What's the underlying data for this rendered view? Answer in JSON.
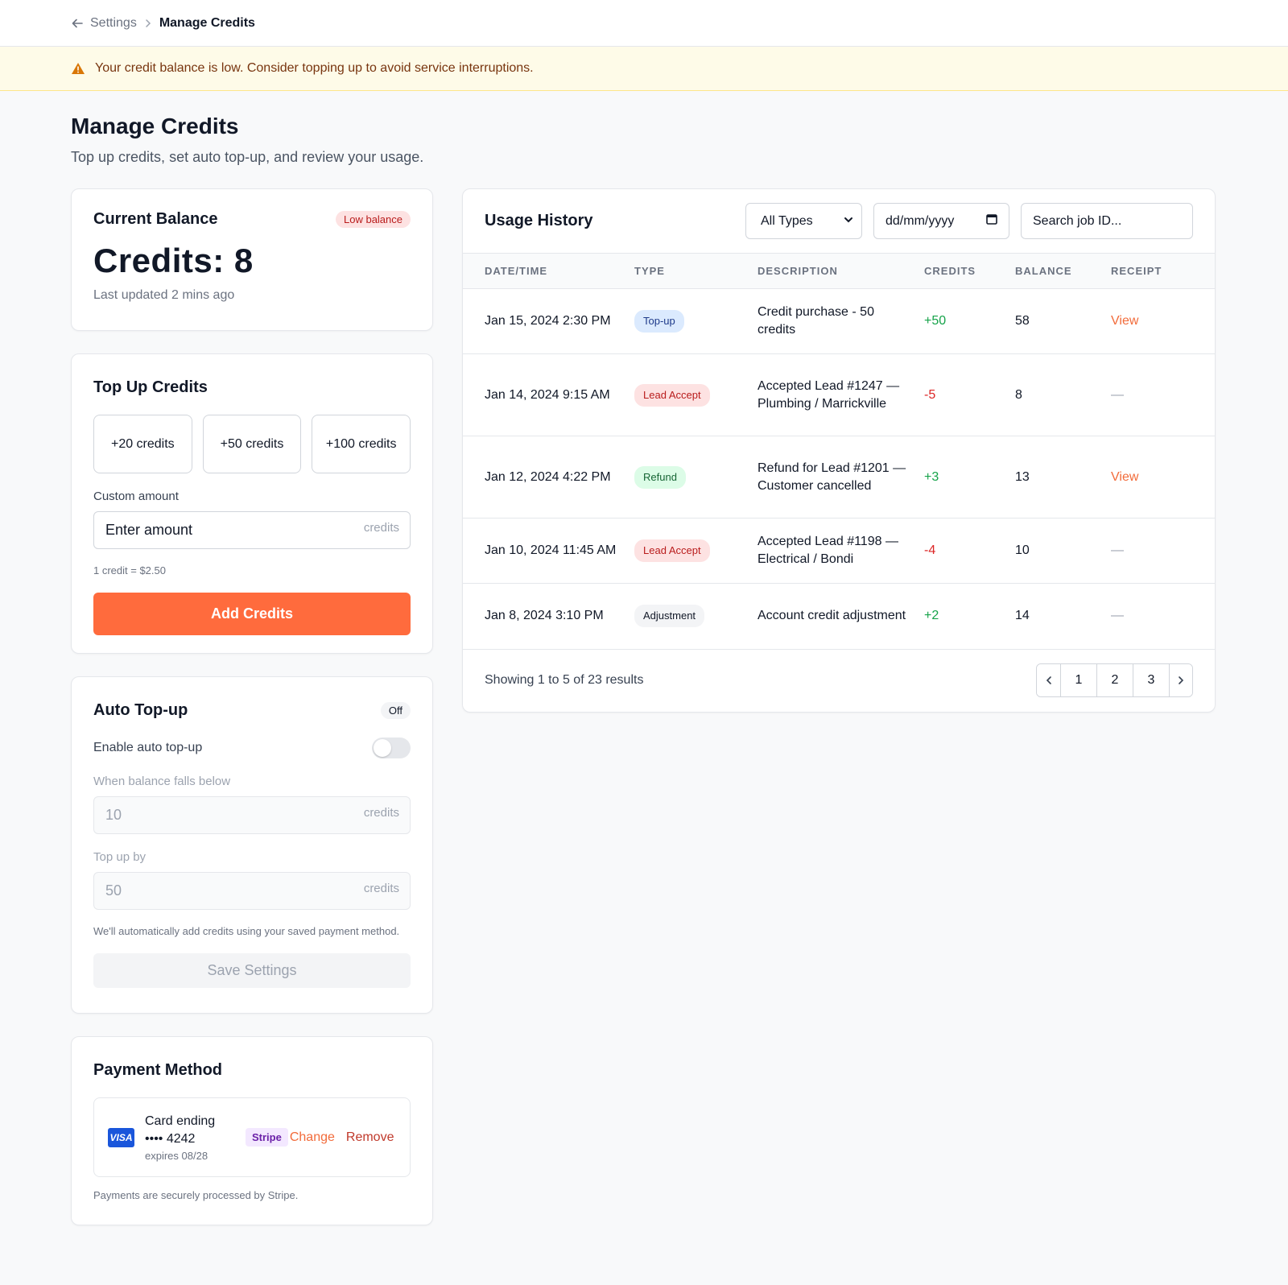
{
  "breadcrumb": {
    "parent": "Settings",
    "current": "Manage Credits"
  },
  "banner": {
    "text": "Your credit balance is low. Consider topping up to avoid service interruptions."
  },
  "page": {
    "title": "Manage Credits",
    "subtitle": "Top up credits, set auto top-up, and review your usage."
  },
  "balance": {
    "title": "Current Balance",
    "badge": "Low balance",
    "credits": "Credits: 8",
    "updated": "Last updated 2 mins ago"
  },
  "topup": {
    "title": "Top Up Credits",
    "quick": [
      "+20 credits",
      "+50 credits",
      "+100 credits"
    ],
    "custom_label": "Custom amount",
    "custom_placeholder": "Enter amount",
    "suffix": "credits",
    "rate": "1 credit = $2.50",
    "button": "Add Credits"
  },
  "auto": {
    "title": "Auto Top-up",
    "status": "Off",
    "enable_label": "Enable auto top-up",
    "threshold_label": "When balance falls below",
    "threshold_value": "10",
    "amount_label": "Top up by",
    "amount_value": "50",
    "suffix": "credits",
    "note": "We'll automatically add credits using your saved payment method.",
    "button": "Save Settings"
  },
  "payment": {
    "title": "Payment Method",
    "brand": "VISA",
    "card_label": "Card ending",
    "card_number": "•••• 4242",
    "expires": "expires 08/28",
    "processor": "Stripe",
    "change": "Change",
    "remove": "Remove",
    "footer": "Payments are securely processed by Stripe."
  },
  "usage": {
    "title": "Usage History",
    "filter_type": "All Types",
    "date_placeholder": "dd/mm/yyyy",
    "search_placeholder": "Search job ID...",
    "columns": [
      "DATE/TIME",
      "TYPE",
      "DESCRIPTION",
      "CREDITS",
      "BALANCE",
      "RECEIPT"
    ],
    "rows": [
      {
        "date": "Jan 15, 2024 2:30 PM",
        "type": "Top-up",
        "desc": "Credit purchase - 50 credits",
        "credits": "+50",
        "balance": "58",
        "receipt": "View"
      },
      {
        "date": "Jan 14, 2024 9:15 AM",
        "type": "Lead Accept",
        "desc": "Accepted Lead #1247 — Plumbing / Marrickville",
        "credits": "-5",
        "balance": "8",
        "receipt": "—"
      },
      {
        "date": "Jan 12, 2024 4:22 PM",
        "type": "Refund",
        "desc": "Refund for Lead #1201 — Customer cancelled",
        "credits": "+3",
        "balance": "13",
        "receipt": "View"
      },
      {
        "date": "Jan 10, 2024 11:45 AM",
        "type": "Lead Accept",
        "desc": "Accepted Lead #1198 — Electrical / Bondi",
        "credits": "-4",
        "balance": "10",
        "receipt": "—"
      },
      {
        "date": "Jan 8, 2024 3:10 PM",
        "type": "Adjustment",
        "desc": "Account credit adjustment",
        "credits": "+2",
        "balance": "14",
        "receipt": "—"
      }
    ],
    "summary": "Showing 1 to 5 of 23 results",
    "pages": [
      "1",
      "2",
      "3"
    ]
  },
  "icons": {
    "back": "arrow-left-icon",
    "separator": "chevron-right-icon",
    "warning": "warning-triangle-icon",
    "select": "chevron-down-icon",
    "calendar": "calendar-icon",
    "prev": "chevron-left-icon",
    "next": "chevron-right-icon"
  },
  "colors": {
    "accent": "#ff6b3d",
    "banner_bg": "#fefbe8",
    "positive": "#16a34a",
    "negative": "#dc2626",
    "link": "#f26b3a"
  }
}
